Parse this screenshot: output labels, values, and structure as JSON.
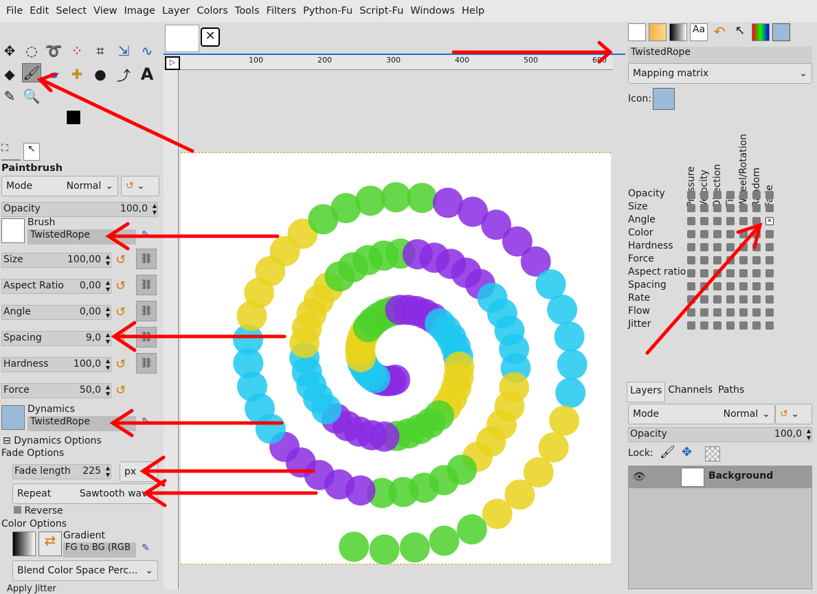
{
  "menubar": [
    "File",
    "Edit",
    "Select",
    "View",
    "Image",
    "Layer",
    "Colors",
    "Tools",
    "Filters",
    "Python-Fu",
    "Script-Fu",
    "Windows",
    "Help"
  ],
  "tool_options": {
    "title": "Paintbrush",
    "mode_label": "Mode",
    "mode_value": "Normal",
    "opacity_label": "Opacity",
    "opacity_value": "100,0",
    "brush_label": "Brush",
    "brush_value": "TwistedRope",
    "size_label": "Size",
    "size_value": "100,00",
    "aspect_label": "Aspect Ratio",
    "aspect_value": "0,00",
    "angle_label": "Angle",
    "angle_value": "0,00",
    "spacing_label": "Spacing",
    "spacing_value": "9,0",
    "hardness_label": "Hardness",
    "hardness_value": "100,0",
    "force_label": "Force",
    "force_value": "50,0",
    "dynamics_label": "Dynamics",
    "dynamics_value": "TwistedRope",
    "dynamics_options": "Dynamics Options",
    "fade_options": "Fade Options",
    "fade_length_label": "Fade length",
    "fade_length_value": "225",
    "fade_unit": "px",
    "repeat_label": "Repeat",
    "repeat_value": "Sawtooth wave",
    "reverse_label": "Reverse",
    "color_options": "Color Options",
    "gradient_label": "Gradient",
    "gradient_value": "FG to BG (RGB",
    "blend_space": "Blend Color Space Perc...",
    "apply_jitter": "Apply Jitter"
  },
  "ruler": [
    "100",
    "200",
    "300",
    "400",
    "500",
    "600"
  ],
  "dynamics_editor": {
    "name": "TwistedRope",
    "view": "Mapping matrix",
    "icon_label": "Icon:",
    "columns": [
      "Pressure",
      "Velocity",
      "Direction",
      "Tilt",
      "Wheel/Rotation",
      "Random",
      "Fade"
    ],
    "rows": [
      "Opacity",
      "Size",
      "Angle",
      "Color",
      "Hardness",
      "Force",
      "Aspect ratio",
      "Spacing",
      "Rate",
      "Flow",
      "Jitter"
    ],
    "checked": "Angle / Fade"
  },
  "layers": {
    "tabs": [
      "Layers",
      "Channels",
      "Paths"
    ],
    "mode_label": "Mode",
    "mode_value": "Normal",
    "opacity_label": "Opacity",
    "opacity_value": "100,0",
    "lock_label": "Lock:",
    "layer_name": "Background"
  },
  "colors": {
    "accent": "#ff0000",
    "fg": "#000000",
    "bg": "#ffffff"
  },
  "icons": [
    "move-icon",
    "ellipse-select-icon",
    "lasso-icon",
    "fuzzy-select-icon",
    "crop-icon",
    "transform-icon",
    "warp-icon",
    "bucket-icon",
    "paintbrush-icon",
    "eraser-icon",
    "heal-icon",
    "ink-icon",
    "paths-icon",
    "text-icon",
    "color-picker-icon",
    "zoom-icon"
  ]
}
